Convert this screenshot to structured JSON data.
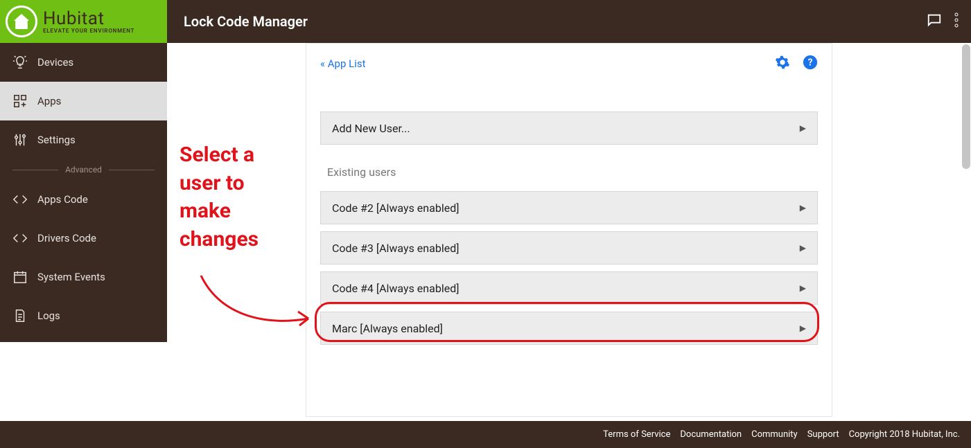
{
  "header": {
    "title": "Lock Code Manager",
    "logo_main": "Hubitat",
    "logo_sub": "ELEVATE YOUR ENVIRONMENT"
  },
  "sidebar": {
    "items": [
      {
        "label": "Devices"
      },
      {
        "label": "Apps"
      },
      {
        "label": "Settings"
      },
      {
        "label": "Apps Code"
      },
      {
        "label": "Drivers Code"
      },
      {
        "label": "System Events"
      },
      {
        "label": "Logs"
      }
    ],
    "advanced_label": "Advanced"
  },
  "panel": {
    "back_link": "« App List",
    "add_user": "Add New User...",
    "existing_label": "Existing users",
    "users": [
      "Code #2 [Always enabled]",
      "Code #3 [Always enabled]",
      "Code #4 [Always enabled]",
      "Marc [Always enabled]"
    ]
  },
  "annotation": {
    "line1": "Select a",
    "line2": "user to",
    "line3": "make",
    "line4": "changes"
  },
  "footer": {
    "links": [
      "Terms of Service",
      "Documentation",
      "Community",
      "Support"
    ],
    "copyright": "Copyright 2018 Hubitat, Inc."
  }
}
